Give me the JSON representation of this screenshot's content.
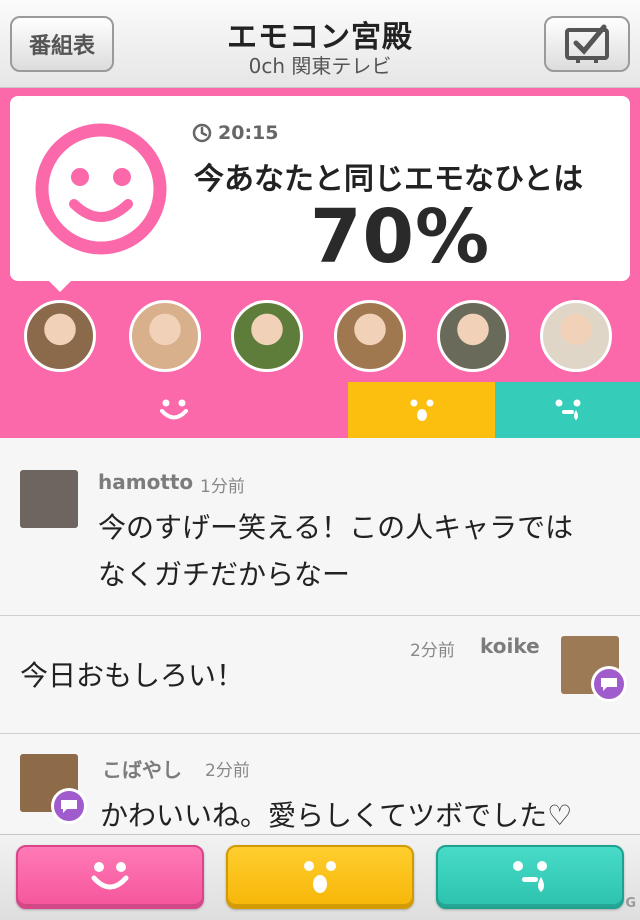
{
  "header": {
    "schedule_label": "番組表",
    "title": "エモコン宮殿",
    "subtitle": "0ch 関東テレビ",
    "tv_icon": "tv-check-icon"
  },
  "summary": {
    "time": "20:15",
    "headline": "今あなたと同じエモなひとは",
    "percent": "70%",
    "emotion_icon": "big-smile-icon",
    "accent_color": "#fb69aa"
  },
  "avatars": [
    {
      "name": "avatar-1",
      "color": "#8a6a4a"
    },
    {
      "name": "avatar-2",
      "color": "#d9b08c"
    },
    {
      "name": "avatar-3",
      "color": "#5f7d3a"
    },
    {
      "name": "avatar-4",
      "color": "#a07850"
    },
    {
      "name": "avatar-5",
      "color": "#6a6a5a"
    },
    {
      "name": "avatar-6",
      "color": "#e0d6c8"
    }
  ],
  "tabs": {
    "happy_color": "#fb69aa",
    "surprised_color": "#fcbf0f",
    "sad_color": "#35cdb9"
  },
  "comments": [
    {
      "user": "hamotto",
      "ago": "1分前",
      "line1": "今のすげー笑える！この人キャラでは",
      "line2": "なくガチだからなー"
    },
    {
      "user": "koike",
      "ago": "2分前",
      "line1": "今日おもしろい！"
    },
    {
      "user": "こばやし",
      "ago": "2分前",
      "line1": "かわいいね。愛らしくてツボでした♡"
    }
  ],
  "watermark": "G"
}
